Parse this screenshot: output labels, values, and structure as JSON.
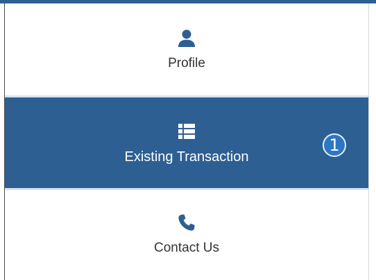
{
  "colors": {
    "accent": "#2d5f93",
    "active_text": "#ffffff",
    "text": "#333333",
    "badge": "#2c77c4"
  },
  "menu": {
    "items": [
      {
        "label": "Profile",
        "icon": "user-icon",
        "active": false
      },
      {
        "label": "Existing Transaction",
        "icon": "list-icon",
        "active": true
      },
      {
        "label": "Contact Us",
        "icon": "phone-icon",
        "active": false
      }
    ]
  },
  "annotation": {
    "badge_number": "1"
  }
}
